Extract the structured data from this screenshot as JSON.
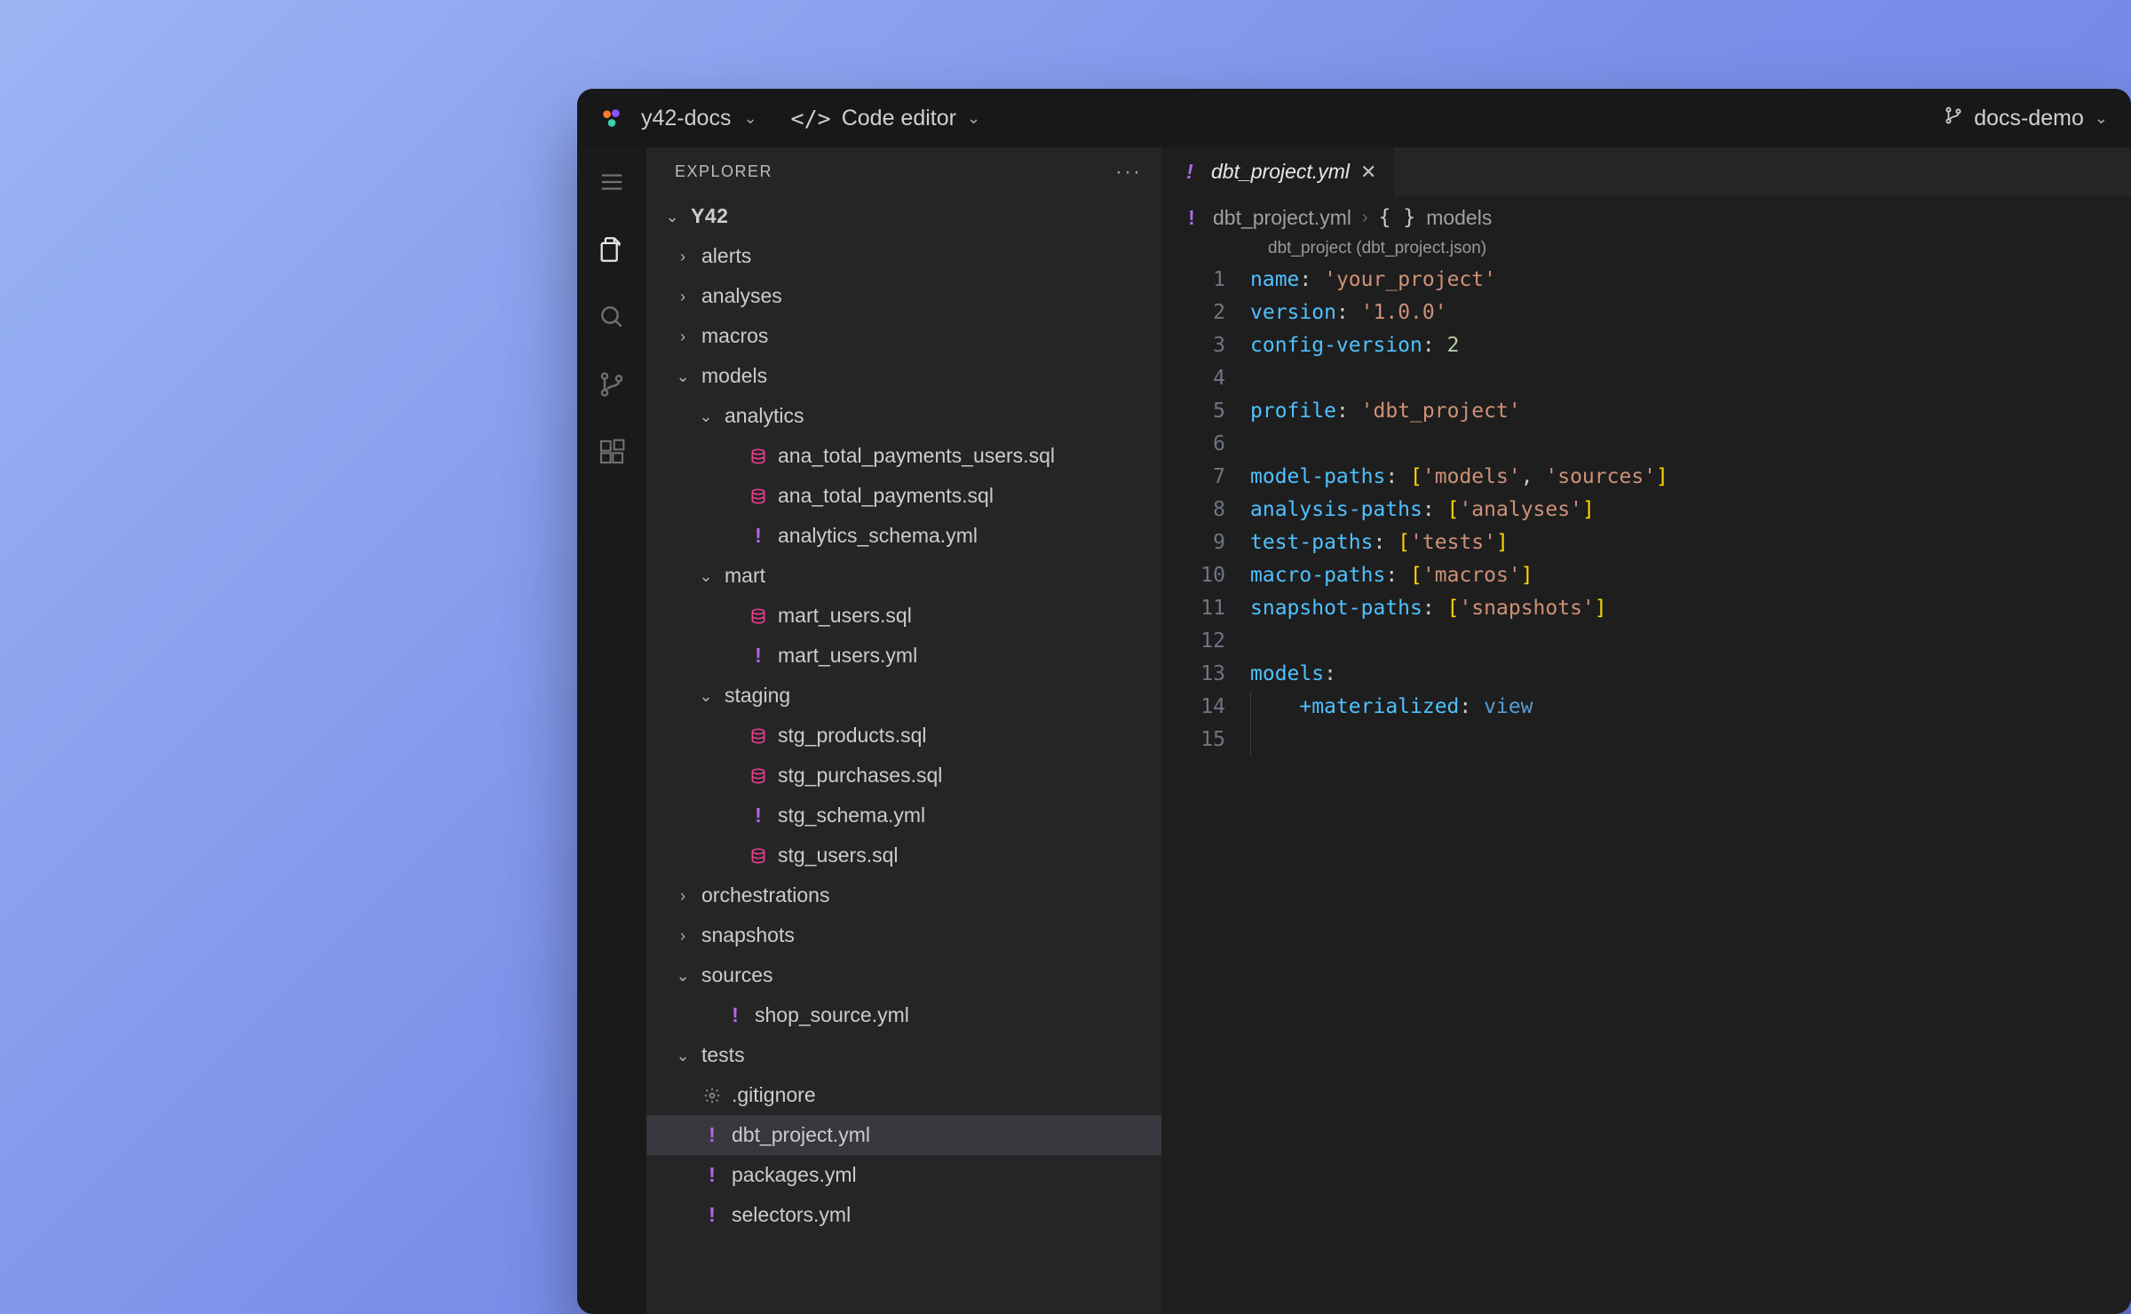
{
  "titlebar": {
    "project_name": "y42-docs",
    "mode_label": "Code editor",
    "branch_name": "docs-demo"
  },
  "sidebar": {
    "title": "EXPLORER",
    "root_label": "Y42",
    "tree": [
      {
        "depth": 1,
        "label": "alerts",
        "expanded": false,
        "icon": "",
        "kind": "folder"
      },
      {
        "depth": 1,
        "label": "analyses",
        "expanded": false,
        "icon": "",
        "kind": "folder"
      },
      {
        "depth": 1,
        "label": "macros",
        "expanded": false,
        "icon": "",
        "kind": "folder"
      },
      {
        "depth": 1,
        "label": "models",
        "expanded": true,
        "icon": "",
        "kind": "folder"
      },
      {
        "depth": 2,
        "label": "analytics",
        "expanded": true,
        "icon": "",
        "kind": "folder"
      },
      {
        "depth": 3,
        "label": "ana_total_payments_users.sql",
        "icon": "sql",
        "kind": "file"
      },
      {
        "depth": 3,
        "label": "ana_total_payments.sql",
        "icon": "sql",
        "kind": "file"
      },
      {
        "depth": 3,
        "label": "analytics_schema.yml",
        "icon": "yml",
        "kind": "file"
      },
      {
        "depth": 2,
        "label": "mart",
        "expanded": true,
        "icon": "",
        "kind": "folder"
      },
      {
        "depth": 3,
        "label": "mart_users.sql",
        "icon": "sql",
        "kind": "file"
      },
      {
        "depth": 3,
        "label": "mart_users.yml",
        "icon": "yml",
        "kind": "file"
      },
      {
        "depth": 2,
        "label": "staging",
        "expanded": true,
        "icon": "",
        "kind": "folder"
      },
      {
        "depth": 3,
        "label": "stg_products.sql",
        "icon": "sql",
        "kind": "file"
      },
      {
        "depth": 3,
        "label": "stg_purchases.sql",
        "icon": "sql",
        "kind": "file"
      },
      {
        "depth": 3,
        "label": "stg_schema.yml",
        "icon": "yml",
        "kind": "file"
      },
      {
        "depth": 3,
        "label": "stg_users.sql",
        "icon": "sql",
        "kind": "file"
      },
      {
        "depth": 1,
        "label": "orchestrations",
        "expanded": false,
        "icon": "",
        "kind": "folder"
      },
      {
        "depth": 1,
        "label": "snapshots",
        "expanded": false,
        "icon": "",
        "kind": "folder"
      },
      {
        "depth": 1,
        "label": "sources",
        "expanded": true,
        "icon": "",
        "kind": "folder"
      },
      {
        "depth": 2,
        "label": "shop_source.yml",
        "icon": "yml",
        "kind": "file"
      },
      {
        "depth": 1,
        "label": "tests",
        "expanded": true,
        "icon": "",
        "kind": "folder"
      },
      {
        "depth": 1,
        "label": ".gitignore",
        "icon": "gear",
        "kind": "file"
      },
      {
        "depth": 1,
        "label": "dbt_project.yml",
        "icon": "yml",
        "kind": "file",
        "selected": true
      },
      {
        "depth": 1,
        "label": "packages.yml",
        "icon": "yml",
        "kind": "file"
      },
      {
        "depth": 1,
        "label": "selectors.yml",
        "icon": "yml",
        "kind": "file"
      }
    ]
  },
  "editor": {
    "tab": {
      "filename": "dbt_project.yml",
      "icon": "yml"
    },
    "breadcrumbs": [
      {
        "icon": "yml",
        "label": "dbt_project.yml"
      },
      {
        "icon": "braces",
        "label": "models"
      }
    ],
    "codelens": "dbt_project (dbt_project.json)",
    "lines": [
      {
        "n": 1,
        "tokens": [
          [
            "key",
            "name"
          ],
          [
            "punc",
            ":"
          ],
          [
            "plain",
            " "
          ],
          [
            "str",
            "'your_project'"
          ]
        ]
      },
      {
        "n": 2,
        "tokens": [
          [
            "key",
            "version"
          ],
          [
            "punc",
            ":"
          ],
          [
            "plain",
            " "
          ],
          [
            "str",
            "'1.0.0'"
          ]
        ]
      },
      {
        "n": 3,
        "tokens": [
          [
            "key",
            "config-version"
          ],
          [
            "punc",
            ":"
          ],
          [
            "plain",
            " "
          ],
          [
            "num",
            "2"
          ]
        ]
      },
      {
        "n": 4,
        "tokens": []
      },
      {
        "n": 5,
        "tokens": [
          [
            "key",
            "profile"
          ],
          [
            "punc",
            ":"
          ],
          [
            "plain",
            " "
          ],
          [
            "str",
            "'dbt_project'"
          ]
        ]
      },
      {
        "n": 6,
        "tokens": []
      },
      {
        "n": 7,
        "tokens": [
          [
            "key",
            "model-paths"
          ],
          [
            "punc",
            ":"
          ],
          [
            "plain",
            " "
          ],
          [
            "brkt",
            "["
          ],
          [
            "str",
            "'models'"
          ],
          [
            "punc",
            ", "
          ],
          [
            "str",
            "'sources'"
          ],
          [
            "brkt",
            "]"
          ]
        ]
      },
      {
        "n": 8,
        "tokens": [
          [
            "key",
            "analysis-paths"
          ],
          [
            "punc",
            ":"
          ],
          [
            "plain",
            " "
          ],
          [
            "brkt",
            "["
          ],
          [
            "str",
            "'analyses'"
          ],
          [
            "brkt",
            "]"
          ]
        ]
      },
      {
        "n": 9,
        "tokens": [
          [
            "key",
            "test-paths"
          ],
          [
            "punc",
            ":"
          ],
          [
            "plain",
            " "
          ],
          [
            "brkt",
            "["
          ],
          [
            "str",
            "'tests'"
          ],
          [
            "brkt",
            "]"
          ]
        ]
      },
      {
        "n": 10,
        "tokens": [
          [
            "key",
            "macro-paths"
          ],
          [
            "punc",
            ":"
          ],
          [
            "plain",
            " "
          ],
          [
            "brkt",
            "["
          ],
          [
            "str",
            "'macros'"
          ],
          [
            "brkt",
            "]"
          ]
        ]
      },
      {
        "n": 11,
        "tokens": [
          [
            "key",
            "snapshot-paths"
          ],
          [
            "punc",
            ":"
          ],
          [
            "plain",
            " "
          ],
          [
            "brkt",
            "["
          ],
          [
            "str",
            "'snapshots'"
          ],
          [
            "brkt",
            "]"
          ]
        ]
      },
      {
        "n": 12,
        "tokens": []
      },
      {
        "n": 13,
        "tokens": [
          [
            "key",
            "models"
          ],
          [
            "punc",
            ":"
          ]
        ]
      },
      {
        "n": 14,
        "tokens": [
          [
            "plain",
            "    "
          ],
          [
            "key",
            "+materialized"
          ],
          [
            "punc",
            ":"
          ],
          [
            "plain",
            " "
          ],
          [
            "const",
            "view"
          ]
        ],
        "guide": true
      },
      {
        "n": 15,
        "tokens": [],
        "guide": true
      }
    ]
  }
}
